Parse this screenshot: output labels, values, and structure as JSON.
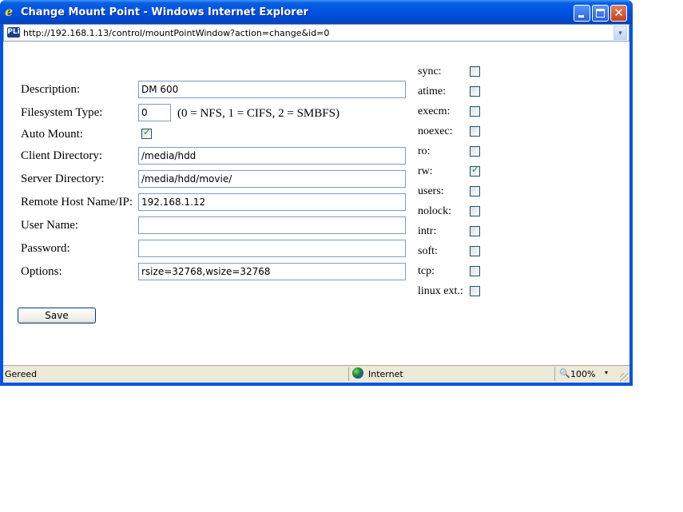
{
  "window": {
    "title": "Change Mount Point - Windows Internet Explorer",
    "title_icon": "ie-logo-icon",
    "buttons": [
      "minimize",
      "maximize",
      "close"
    ],
    "close_glyph": "✕"
  },
  "address_bar": {
    "favicon_text": "PLi",
    "url": "http://192.168.1.13/control/mountPointWindow?action=change&id=0",
    "dropdown_glyph": "▾"
  },
  "form": {
    "description": {
      "label": "Description:",
      "value": "DM 600"
    },
    "filesystem_type": {
      "label": "Filesystem Type:",
      "value": "0",
      "hint": "(0 = NFS, 1 = CIFS, 2 = SMBFS)"
    },
    "auto_mount": {
      "label": "Auto Mount:",
      "checked": true
    },
    "client_directory": {
      "label": "Client Directory:",
      "value": "/media/hdd"
    },
    "server_directory": {
      "label": "Server Directory:",
      "value": "/media/hdd/movie/"
    },
    "remote_host": {
      "label": "Remote Host Name/IP:",
      "value": "192.168.1.12"
    },
    "user_name": {
      "label": "User Name:",
      "value": ""
    },
    "password": {
      "label": "Password:",
      "value": ""
    },
    "options": {
      "label": "Options:",
      "value": "rsize=32768,wsize=32768"
    },
    "save_label": "Save",
    "tick_glyph": "✓"
  },
  "mount_options": [
    {
      "label": "sync:",
      "checked": false
    },
    {
      "label": "atime:",
      "checked": false
    },
    {
      "label": "execm:",
      "checked": false
    },
    {
      "label": "noexec:",
      "checked": false
    },
    {
      "label": "ro:",
      "checked": false
    },
    {
      "label": "rw:",
      "checked": true
    },
    {
      "label": "users:",
      "checked": false
    },
    {
      "label": "nolock:",
      "checked": false
    },
    {
      "label": "intr:",
      "checked": false
    },
    {
      "label": "soft:",
      "checked": false
    },
    {
      "label": "tcp:",
      "checked": false
    },
    {
      "label": "linux ext.:",
      "checked": false
    }
  ],
  "status_bar": {
    "status": "Gereed",
    "zone": "Internet",
    "zoom": "100%",
    "zoom_dropdown_glyph": "▾"
  },
  "colors": {
    "titlebar_blue": "#0054e3",
    "checkmark_green": "#21a121",
    "statusbar_bg": "#ece9d8"
  }
}
